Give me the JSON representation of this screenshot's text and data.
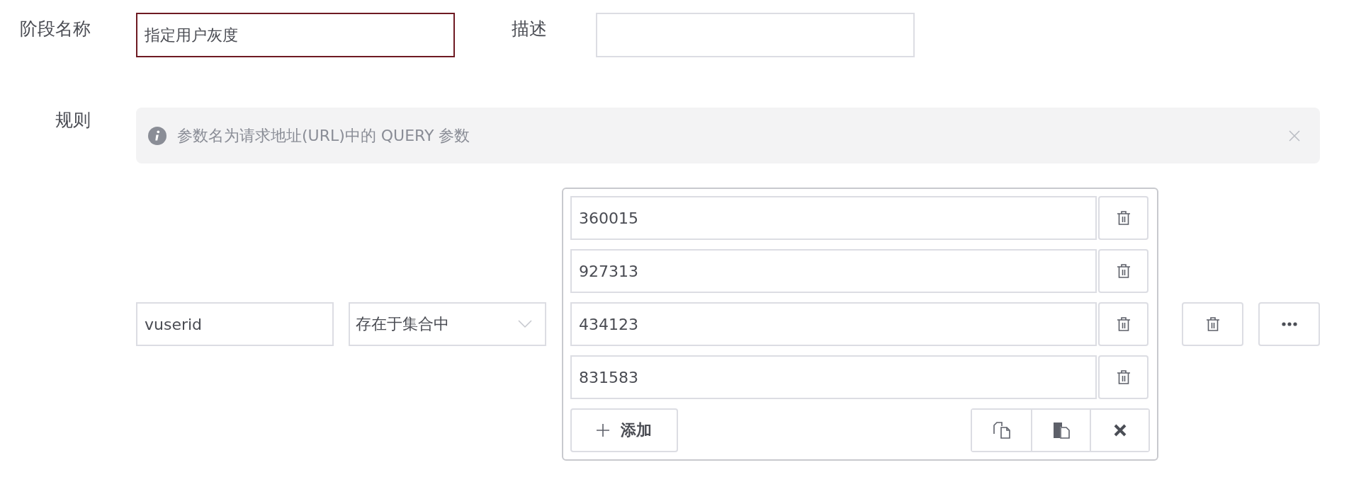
{
  "stage_name": {
    "label": "阶段名称",
    "value": "指定用户灰度",
    "focused": true
  },
  "description": {
    "label": "描述"
  },
  "rules": {
    "label": "规则",
    "alert": {
      "text": "参数名为请求地址(URL)中的 QUERY 参数"
    },
    "rule": {
      "param": "vuserid",
      "operator": "存在于集合中",
      "values": [
        "360015",
        "927313",
        "434123",
        "831583"
      ],
      "add_button": "添加"
    }
  }
}
